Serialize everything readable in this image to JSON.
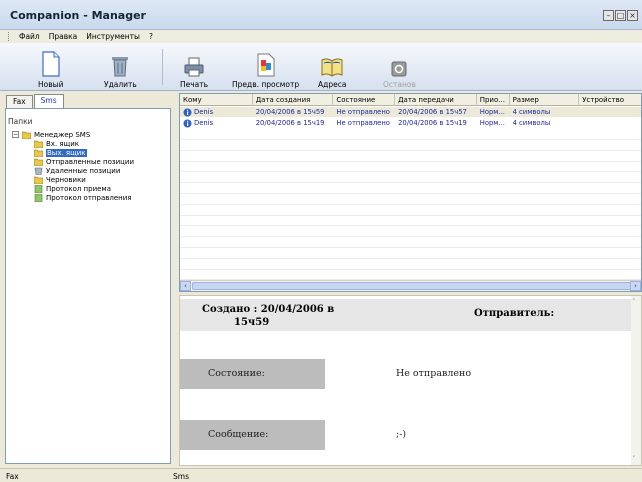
{
  "window": {
    "title": "Companion - Manager"
  },
  "menu": [
    "Файл",
    "Правка",
    "Инструменты",
    "?"
  ],
  "toolbar": {
    "new": "Новый",
    "delete": "Удалить",
    "print": "Печать",
    "preview": "Предв. просмотр",
    "addresses": "Адреса",
    "stop": "Останов"
  },
  "tabs": {
    "fax": "Fax",
    "sms": "Sms"
  },
  "folders": {
    "header": "Папки",
    "root": "Менеджер SMS",
    "items": [
      "Вх. ящик",
      "Вых. ящик",
      "Отправленные позиции",
      "Удаленные позиции",
      "Черновики",
      "Протокол приема",
      "Протокол отправления"
    ]
  },
  "grid": {
    "columns": [
      "Кому",
      "Дата создания",
      "Состояние",
      "Дата передачи",
      "Прио...",
      "Размер",
      "Устройство"
    ],
    "rows": [
      [
        "Denis",
        "20/04/2006 в 15ч59",
        "Не отправлено",
        "20/04/2006 в 15ч57",
        "Норм...",
        "4 символы",
        ""
      ],
      [
        "Denis",
        "20/04/2006 в 15ч19",
        "Не отправлено",
        "20/04/2006 в 15ч19",
        "Норм...",
        "4 символы",
        ""
      ]
    ]
  },
  "detail": {
    "created_line1": "Создано : 20/04/2006 в",
    "created_line2": "15ч59",
    "sender": "Отправитель:",
    "status_label": "Состояние:",
    "status_value": "Не отправлено",
    "message_label": "Сообщение:",
    "message_value": ";-)"
  },
  "status": {
    "left": "Fax",
    "right": "Sms"
  }
}
